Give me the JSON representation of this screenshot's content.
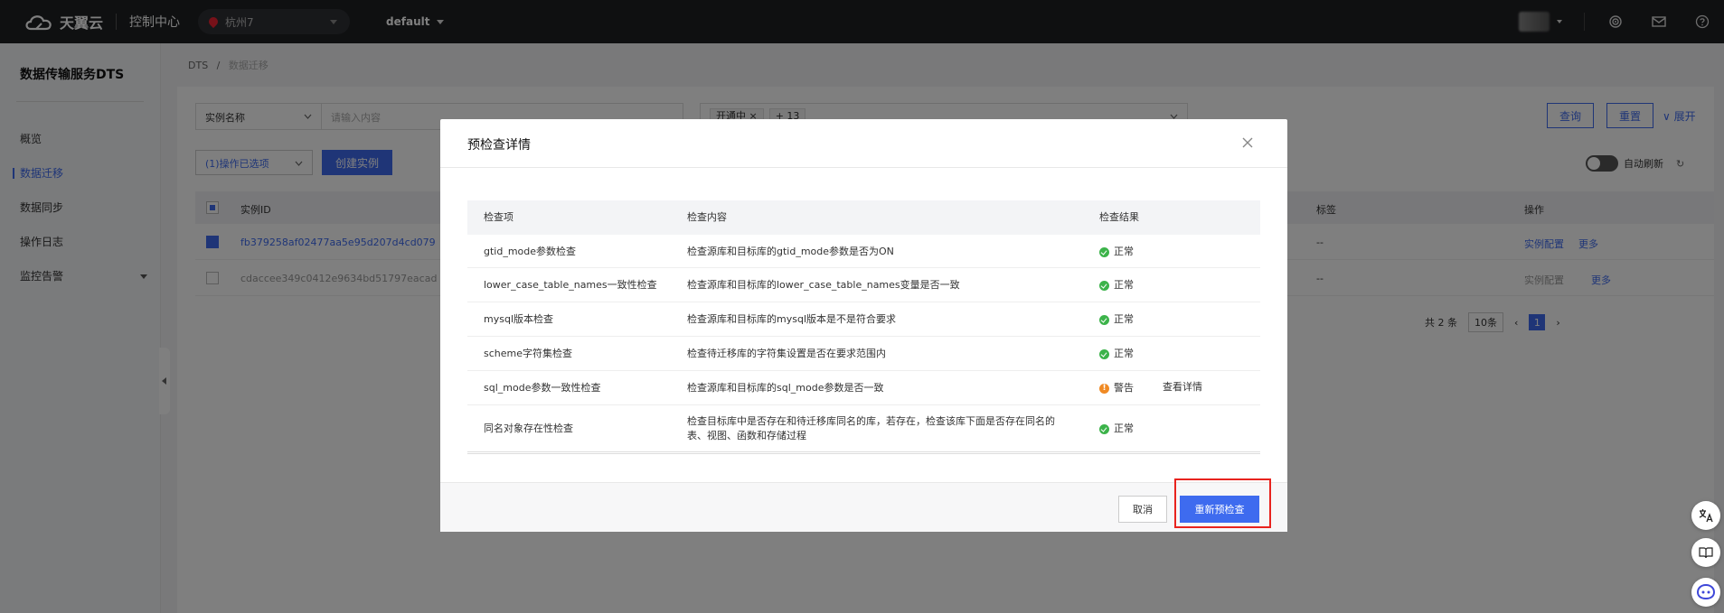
{
  "topbar": {
    "brand": "天翼云",
    "console": "控制中心",
    "region": "杭州7",
    "project": "default"
  },
  "sidebar": {
    "title": "数据传输服务DTS",
    "items": [
      {
        "label": "概览"
      },
      {
        "label": "数据迁移"
      },
      {
        "label": "数据同步"
      },
      {
        "label": "操作日志"
      },
      {
        "label": "监控告警"
      }
    ]
  },
  "breadcrumb": {
    "root": "DTS",
    "sep": "/",
    "current": "数据迁移"
  },
  "filter": {
    "field": "实例名称",
    "placeholder": "请输入内容",
    "chip1": "开通中",
    "chip2": "+ 13",
    "query": "查询",
    "reset": "重置",
    "expand": "展开"
  },
  "toolbar": {
    "ops": "(1)操作已选项",
    "create": "创建实例",
    "auto_refresh": "自动刷新"
  },
  "table": {
    "headers": {
      "id": "实例ID",
      "tag": "标签",
      "ops": "操作"
    },
    "rows": [
      {
        "id": "fb379258af02477aa5e95d207d4cd079",
        "tag": "--",
        "op1": "实例配置",
        "op2": "更多"
      },
      {
        "id": "cdaccee349c0412e9634bd51797eacad",
        "tag": "--",
        "op1": "实例配置",
        "op2": "更多"
      }
    ],
    "total": "共 2 条",
    "page_size": "10条",
    "page": "1"
  },
  "modal": {
    "title": "预检查详情",
    "headers": {
      "item": "检查项",
      "content": "检查内容",
      "result": "检查结果"
    },
    "rows": [
      {
        "item": "gtid_mode参数检查",
        "content": "检查源库和目标库的gtid_mode参数是否为ON",
        "result": "正常",
        "status": "ok"
      },
      {
        "item": "lower_case_table_names一致性检查",
        "content": "检查源库和目标库的lower_case_table_names变量是否一致",
        "result": "正常",
        "status": "ok"
      },
      {
        "item": "mysql版本检查",
        "content": "检查源库和目标库的mysql版本是不是符合要求",
        "result": "正常",
        "status": "ok"
      },
      {
        "item": "scheme字符集检查",
        "content": "检查待迁移库的字符集设置是否在要求范围内",
        "result": "正常",
        "status": "ok"
      },
      {
        "item": "sql_mode参数一致性检查",
        "content": "检查源库和目标库的sql_mode参数是否一致",
        "result": "警告",
        "status": "warn",
        "detail": "查看详情"
      },
      {
        "item": "同名对象存在性检查",
        "content_line1": "检查目标库中是否存在和待迁移库同名的库，若存在，检查该库下面是否存在同名的",
        "content_line2": "表、视图、函数和存储过程",
        "result": "正常",
        "status": "ok"
      }
    ],
    "cancel": "取消",
    "recheck": "重新预检查"
  },
  "colors": {
    "primary": "#3e6bef",
    "ok": "#3cb34a",
    "warn": "#f08a24",
    "highlight": "#e8231e"
  }
}
